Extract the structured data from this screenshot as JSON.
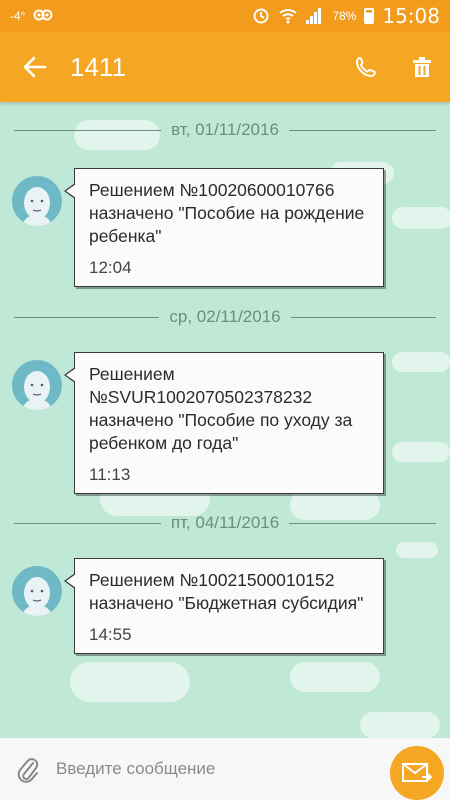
{
  "status_bar": {
    "left_indicator": "-4°",
    "battery": "78%",
    "time": "15:08"
  },
  "header": {
    "title": "1411"
  },
  "messages": [
    {
      "date": "вт, 01/11/2016",
      "text": "Решением №10020600010766 назначено \"Пособие на рождение ребенка\"",
      "time": "12:04"
    },
    {
      "date": "ср, 02/11/2016",
      "text": "Решением\n№SVUR1002070502378232 назначено \"Пособие по уходу за ребенком до года\"",
      "time": "11:13"
    },
    {
      "date": "пт, 04/11/2016",
      "text": "Решением №10021500010152 назначено \"Бюджетная субсидия\"",
      "time": "14:55"
    }
  ],
  "input": {
    "placeholder": "Введите сообщение"
  },
  "colors": {
    "accent": "#f5a623",
    "background": "#bfe8d6"
  },
  "icons": {
    "back": "arrow-left-icon",
    "call": "phone-icon",
    "delete": "trash-icon",
    "attach": "paperclip-icon",
    "send": "envelope-send-icon"
  }
}
